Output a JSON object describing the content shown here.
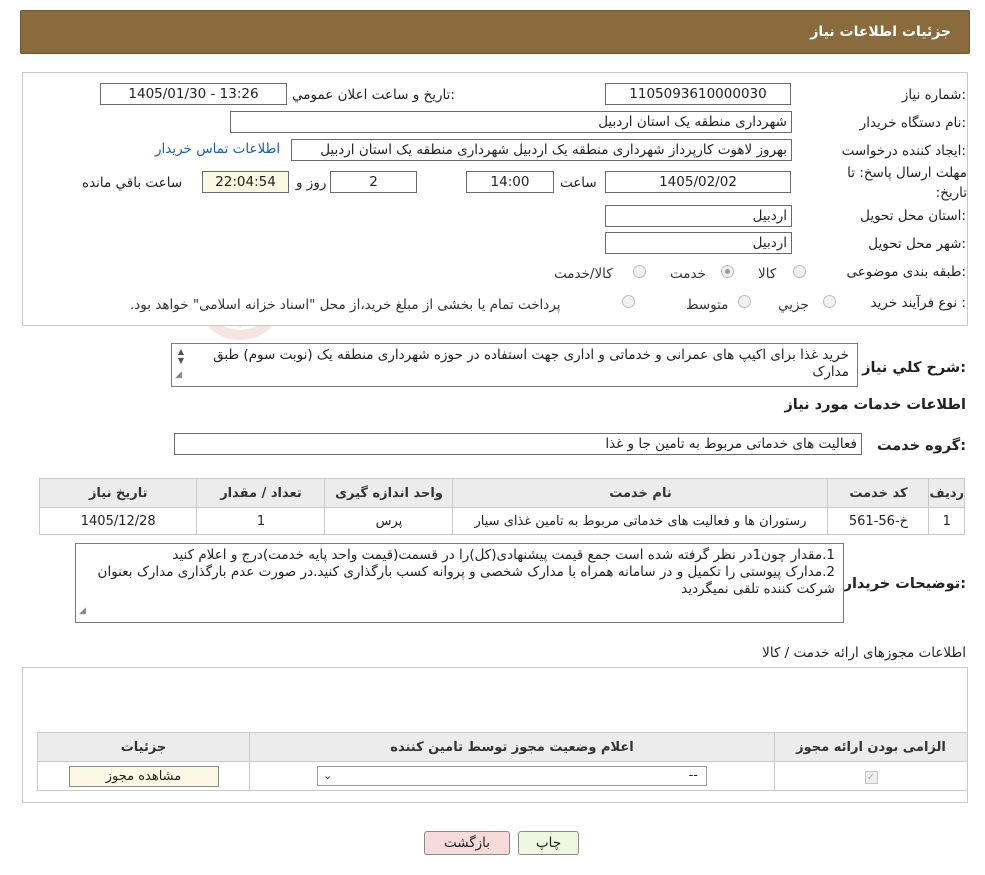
{
  "header": {
    "title": "جزئیات اطلاعات نیاز"
  },
  "form": {
    "need_number": {
      "label": "شماره نیاز:",
      "value": "1105093610000030"
    },
    "announce_datetime": {
      "label": "تاریخ و ساعت اعلان عمومي:",
      "value": "1405/01/30 - 13:26"
    },
    "buyer_org": {
      "label": "نام دستگاه خریدار:",
      "value": "شهرداری منطقه یک استان اردبیل"
    },
    "requester": {
      "label": "ایجاد کننده درخواست:",
      "value": "بهروز لاهوت کارپرداز شهرداری منطقه یک اردبیل شهرداری منطقه یک استان اردبیل",
      "contact_link": "اطلاعات تماس خریدار"
    },
    "deadline": {
      "label": "مهلت ارسال پاسخ: تا تاریخ:",
      "date": "1405/02/02",
      "time_label": "ساعت",
      "time": "14:00",
      "days": "2",
      "days_label": "روز و",
      "remaining": "22:04:54",
      "remaining_label": "ساعت باقي مانده"
    },
    "delivery_province": {
      "label": "استان محل تحویل:",
      "value": "اردبیل"
    },
    "delivery_city": {
      "label": "شهر محل تحویل:",
      "value": "اردبیل"
    },
    "category": {
      "label": "طبقه بندی موضوعی:",
      "options": [
        "کالا",
        "خدمت",
        "کالا/خدمت"
      ],
      "selected": "خدمت"
    },
    "purchase_type": {
      "label": "نوع فرآیند خرید :",
      "options": [
        "جزیي",
        "متوسط"
      ],
      "note": "پرداخت تمام یا بخشی از مبلغ خرید،از محل \"اسناد خزانه اسلامی\" خواهد بود."
    }
  },
  "summary": {
    "label": "شرح کلي نیاز:",
    "value": "خرید غذا برای اکیپ های عمرانی و خدماتی و اداری جهت استفاده در حوزه شهرداری منطقه یک (نوبت سوم) طبق مدارک"
  },
  "services": {
    "title": "اطلاعات خدمات مورد نیاز",
    "group_label": "گروه خدمت:",
    "group_value": "فعالیت های خدماتی مربوط به تامین جا و غذا",
    "columns": [
      "ردیف",
      "کد خدمت",
      "نام خدمت",
      "واحد اندازه گیری",
      "تعداد / مقدار",
      "تاریخ نیاز"
    ],
    "rows": [
      [
        "1",
        "خ-56-561",
        "رستوران ها و فعالیت های خدماتی مربوط به تامین غذای سیار",
        "پرس",
        "1",
        "1405/12/28"
      ]
    ]
  },
  "buyer_notes": {
    "label": "توضیحات خریدار:",
    "lines": [
      "1.مقدار چون1در نظر گرفته شده است جمع قیمت پیشنهادی(کل)را در قسمت(قیمت واحد پایه خدمت)درج و اعلام کنید",
      "2.مدارک پیوستی را تکمیل و در سامانه همراه با مدارک شخصی و پروانه کسب بارگذاری کنید.در صورت عدم بارگذاری مدارک بعنوان شرکت کننده تلقی نمیگردید"
    ]
  },
  "permits": {
    "title": "اطلاعات مجوزهای ارائه خدمت / کالا",
    "columns": [
      "الزامی بودن ارائه مجوز",
      "اعلام وضعیت مجوز توسط تامین کننده",
      "جزئیات"
    ],
    "select_value": "--",
    "view_button": "مشاهده مجوز"
  },
  "buttons": {
    "print": "چاپ",
    "back": "بازگشت"
  },
  "watermark": {
    "text": "AriaTender.neT"
  },
  "colors": {
    "header": "#8a6b3e",
    "link": "#1a5fb4",
    "back_button": "#f7dada",
    "print_button": "#eef7df"
  }
}
